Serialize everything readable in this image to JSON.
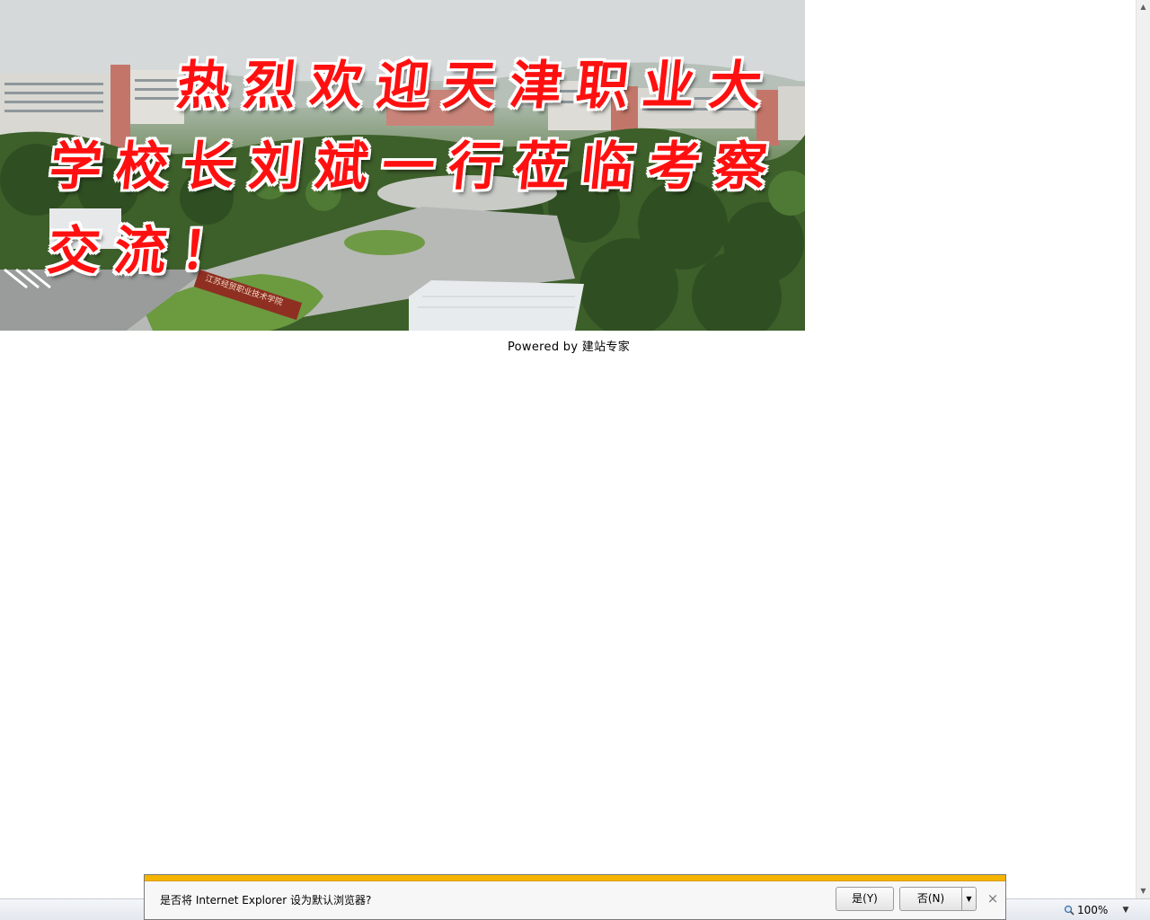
{
  "banner": {
    "line1": "热烈欢迎天津职业大",
    "line2": "学校长刘斌一行莅临考察",
    "line3": "交流！",
    "gate_sign": "江苏经贸职业技术学院"
  },
  "footer": {
    "powered_prefix": "Powered by",
    "powered_link": "建站专家"
  },
  "statusbar": {
    "zoom": "100%"
  },
  "notification": {
    "message": "是否将 Internet Explorer 设为默认浏览器?",
    "yes_label": "是(Y)",
    "no_label": "否(N)",
    "close_glyph": "×",
    "stripe_color": "#f5b400"
  }
}
